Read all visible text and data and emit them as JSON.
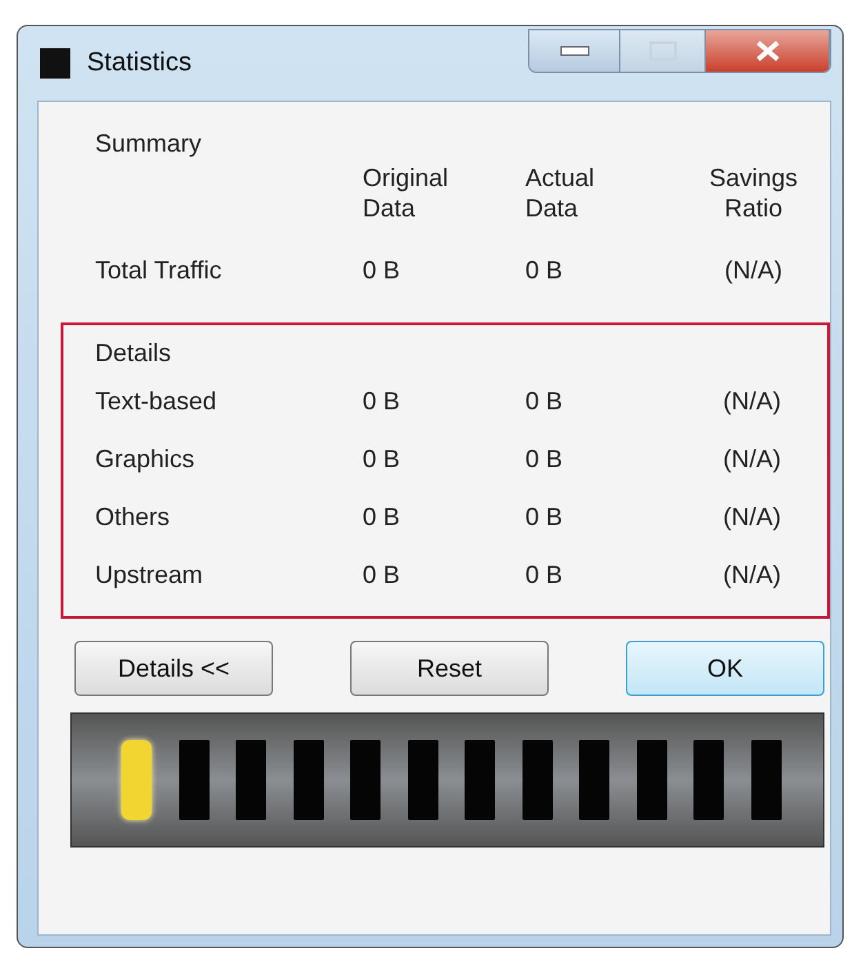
{
  "window": {
    "title": "Statistics"
  },
  "summary": {
    "heading": "Summary",
    "columns": [
      "Original\nData",
      "Actual\nData",
      "Savings\nRatio"
    ],
    "rows": [
      {
        "label": "Total Traffic",
        "cells": [
          "0 B",
          "0 B",
          "(N/A)"
        ]
      }
    ]
  },
  "details": {
    "heading": "Details",
    "highlighted": true,
    "rows": [
      {
        "label": "Text-based",
        "cells": [
          "0 B",
          "0 B",
          "(N/A)"
        ]
      },
      {
        "label": "Graphics",
        "cells": [
          "0 B",
          "0 B",
          "(N/A)"
        ]
      },
      {
        "label": "Others",
        "cells": [
          "0 B",
          "0 B",
          "(N/A)"
        ]
      },
      {
        "label": "Upstream",
        "cells": [
          "0 B",
          "0 B",
          "(N/A)"
        ]
      }
    ]
  },
  "buttons": [
    {
      "label": "Details <<",
      "default": false
    },
    {
      "label": "Reset",
      "default": false
    },
    {
      "label": "OK",
      "default": true
    }
  ],
  "meter": {
    "level": 0.083
  }
}
